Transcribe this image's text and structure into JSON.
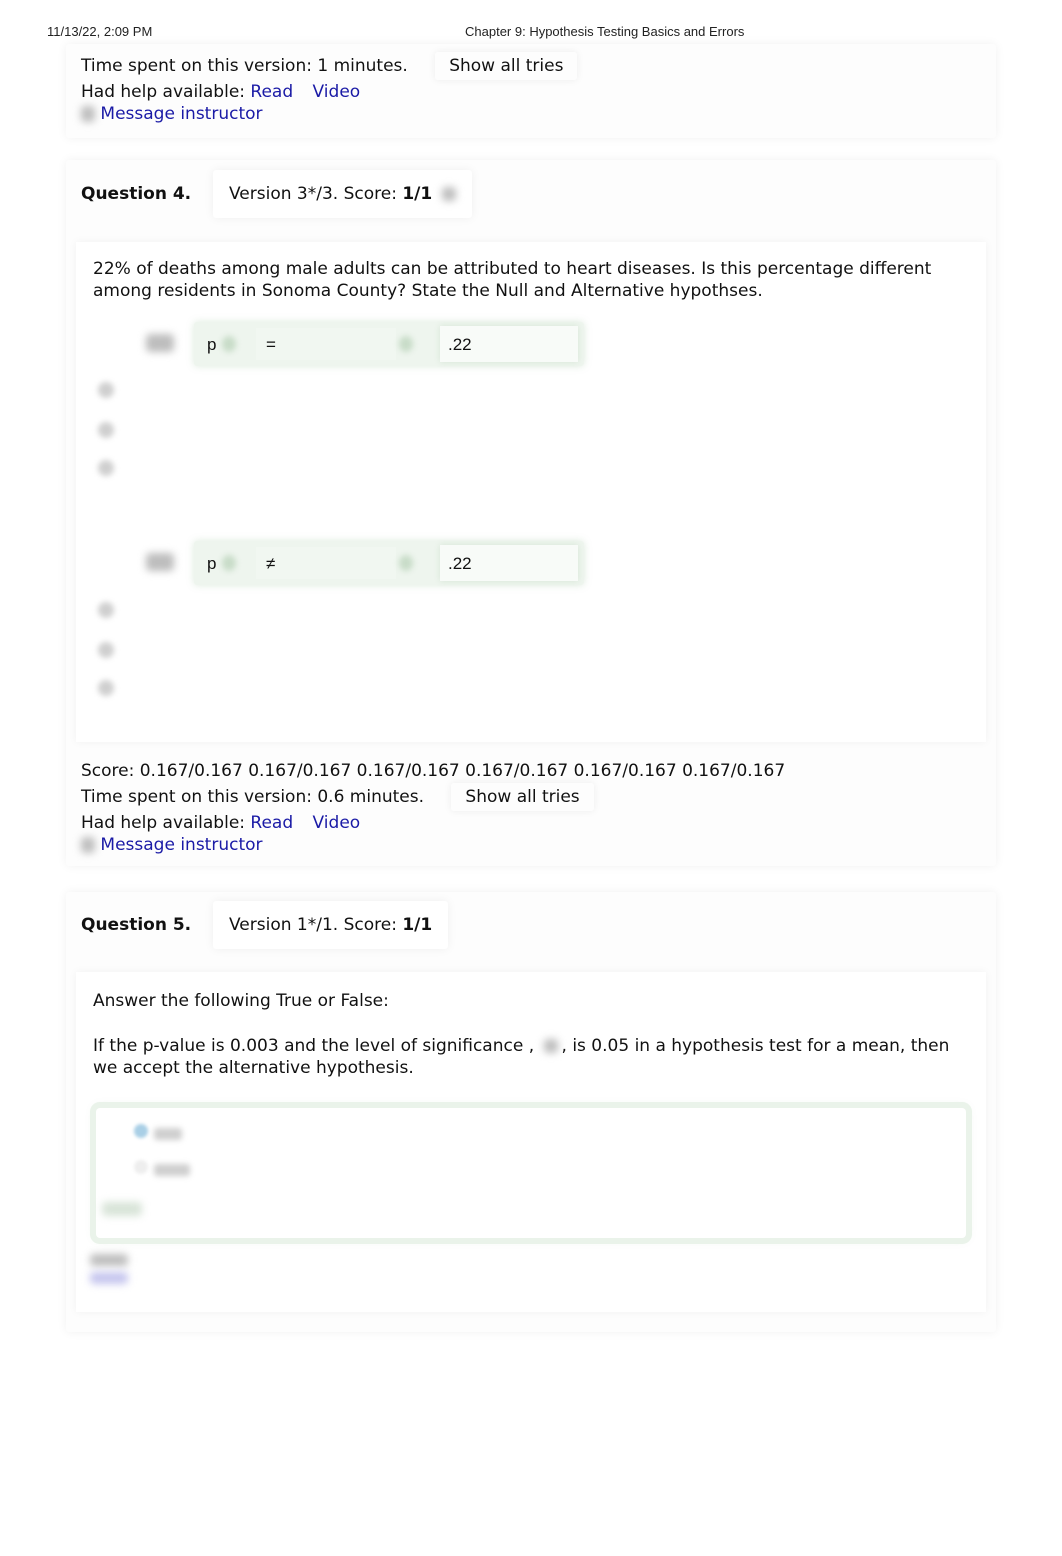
{
  "print_header": {
    "datetime": "11/13/22, 2:09 PM",
    "page_title": "Chapter 9: Hypothesis Testing Basics and Errors"
  },
  "q3_footer": {
    "time_spent": "Time spent on this version: 1 minutes.",
    "show_all_tries": "Show all tries",
    "help_label": "Had help available:",
    "help_read": "Read",
    "help_video": "Video",
    "message_instructor": "Message instructor"
  },
  "question4": {
    "number": "Question 4.",
    "version_prefix": "Version 3*/3. Score: ",
    "score": "1/1",
    "text": "22% of deaths among male adults can be attributed to heart diseases. Is this percentage different among residents in Sonoma County? State the Null and Alternative hypothses.",
    "null_hypothesis": {
      "parameter": "p",
      "operator": "=",
      "value": ".22"
    },
    "alt_hypothesis": {
      "parameter": "p",
      "operator": "≠",
      "value": ".22"
    },
    "footer": {
      "score_line": "Score: 0.167/0.167 0.167/0.167 0.167/0.167 0.167/0.167 0.167/0.167 0.167/0.167",
      "time_spent": "Time spent on this version: 0.6 minutes.",
      "show_all_tries": "Show all tries",
      "help_label": "Had help available:",
      "help_read": "Read",
      "help_video": "Video",
      "message_instructor": "Message instructor"
    }
  },
  "question5": {
    "number": "Question 5.",
    "version_prefix": "Version 1*/1. Score: ",
    "score": "1/1",
    "instruction": "Answer the following True or False:",
    "text_before": "If the p-value is 0.003 and the level of significance ,",
    "text_after": ", is 0.05 in a hypothesis test for a mean, then we accept the alternative hypothesis.",
    "accent_selected": "#a9cfe6"
  }
}
